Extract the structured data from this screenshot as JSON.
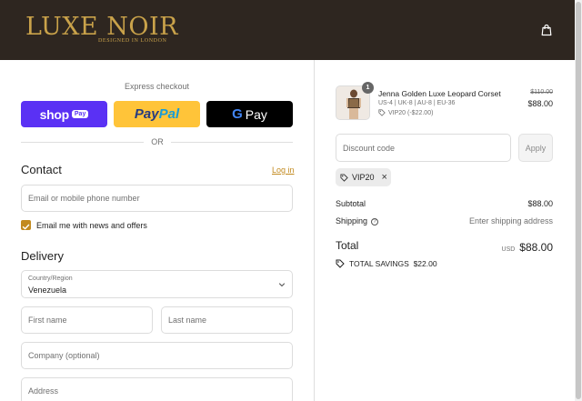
{
  "header": {
    "brand": "LUXE NOIR",
    "brand_tagline": "DESIGNED IN LONDON",
    "brand_color": "#c9a24a",
    "background_color": "#2e2620",
    "cart_icon": "shopping-bag-icon"
  },
  "checkout": {
    "express_label": "Express checkout",
    "buttons": {
      "shop_pay": "shop",
      "shop_pay_badge": "Pay",
      "paypal_part1": "Pay",
      "paypal_part2": "Pal",
      "gpay_g": "G",
      "gpay": "Pay"
    },
    "or_label": "OR",
    "contact": {
      "heading": "Contact",
      "login_link": "Log in",
      "email_placeholder": "Email or mobile phone number",
      "newsletter_label": "Email me with news and offers",
      "newsletter_checked": true
    },
    "delivery": {
      "heading": "Delivery",
      "country_label": "Country/Region",
      "country_value": "Venezuela",
      "first_name_placeholder": "First name",
      "last_name_placeholder": "Last name",
      "company_placeholder": "Company (optional)",
      "address_placeholder": "Address"
    },
    "accent_color": "#c28a1f"
  },
  "summary": {
    "item": {
      "quantity": "1",
      "name": "Jenna Golden Luxe Leopard Corset",
      "variant": "US-4 | UK-8 | AU-8 | EU-36",
      "discount": "VIP20 (-$22.00)",
      "original_price": "$110.00",
      "price": "$88.00"
    },
    "discount_placeholder": "Discount code",
    "apply_label": "Apply",
    "applied_code": "VIP20",
    "subtotal_label": "Subtotal",
    "subtotal_value": "$88.00",
    "shipping_label": "Shipping",
    "shipping_value": "Enter shipping address",
    "total_label": "Total",
    "total_currency": "USD",
    "total_value": "$88.00",
    "savings_label": "TOTAL SAVINGS",
    "savings_value": "$22.00"
  }
}
